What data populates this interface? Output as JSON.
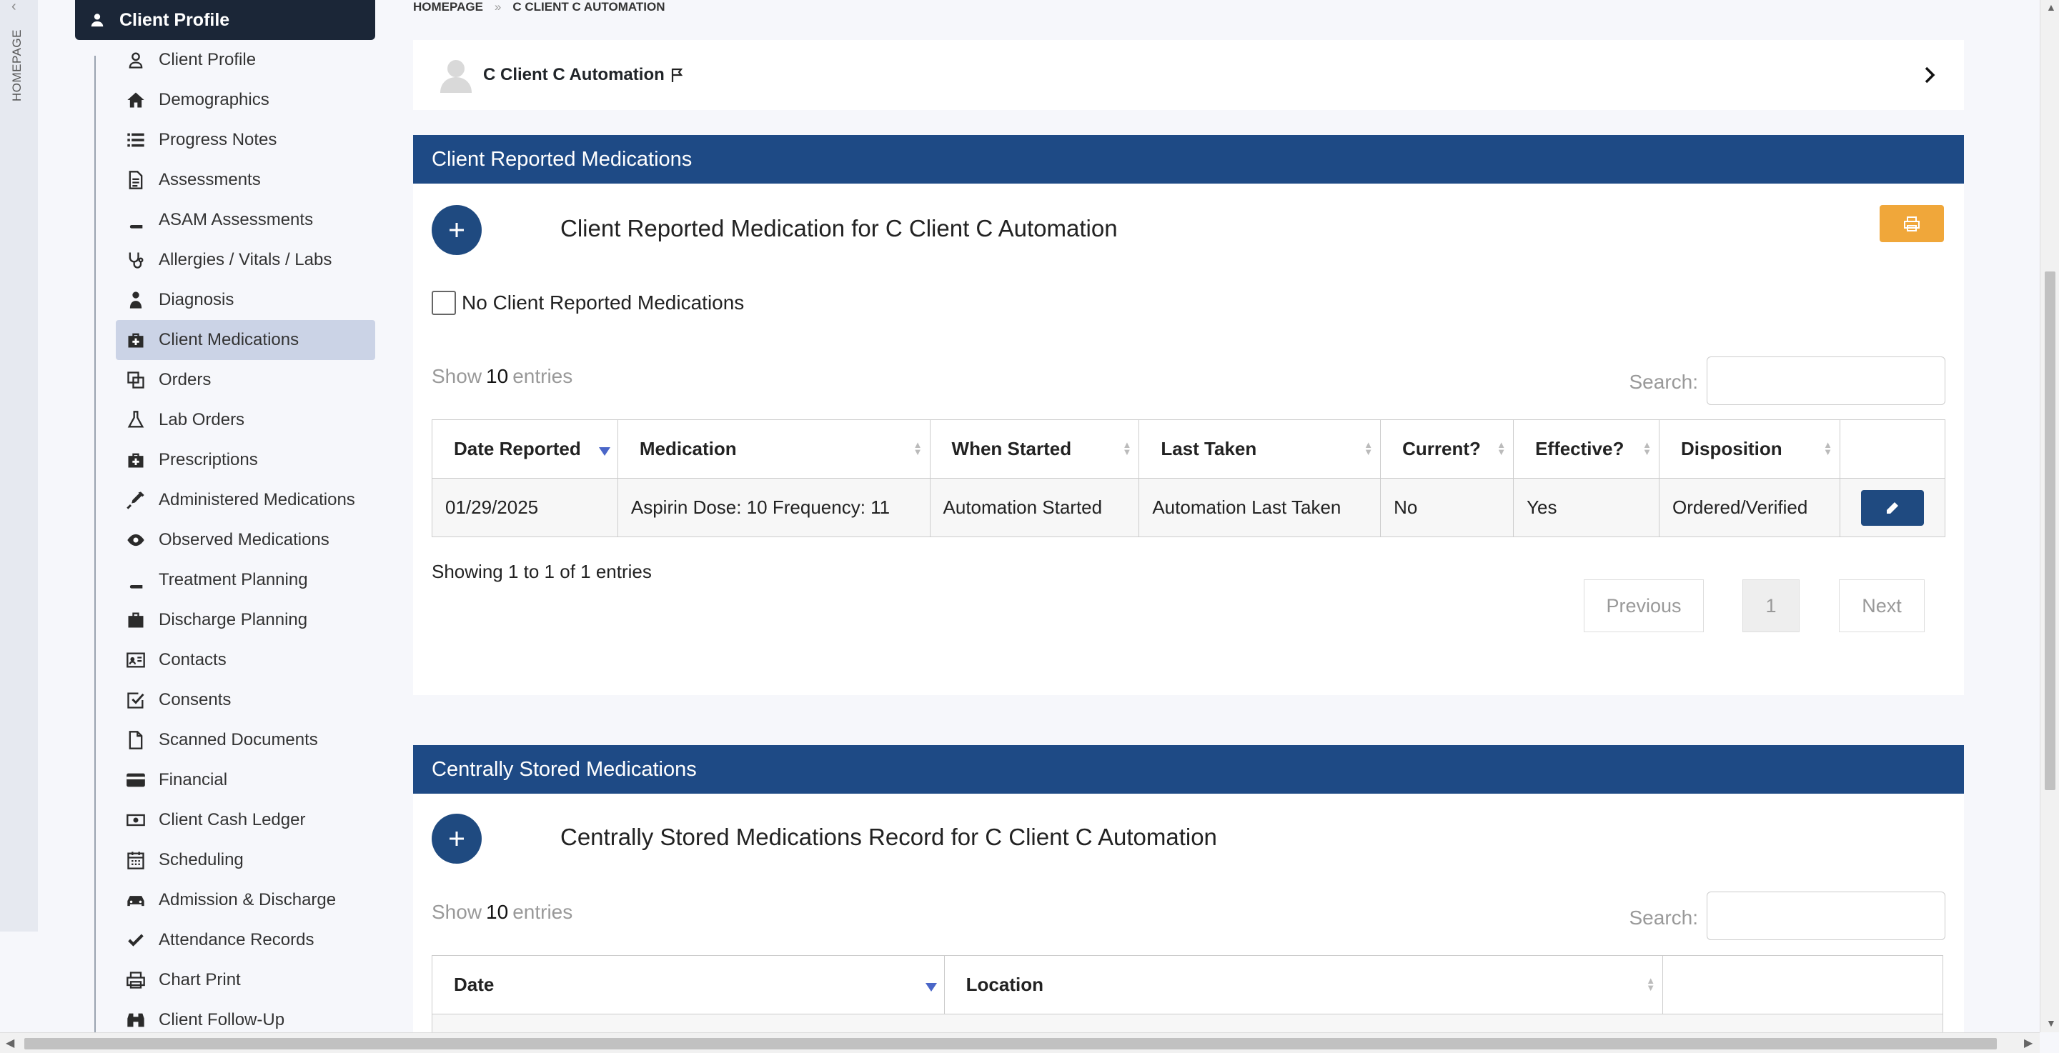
{
  "nav": {
    "collapse_icon": "chevron-left-icon",
    "vertical_label": "HOMEPAGE"
  },
  "sidebar": {
    "header": "Client Profile",
    "items": [
      {
        "label": "Client Profile",
        "icon": "person-icon"
      },
      {
        "label": "Demographics",
        "icon": "home-icon"
      },
      {
        "label": "Progress Notes",
        "icon": "list-icon"
      },
      {
        "label": "Assessments",
        "icon": "document-icon"
      },
      {
        "label": "ASAM Assessments",
        "icon": "book-icon"
      },
      {
        "label": "Allergies / Vitals / Labs",
        "icon": "stethoscope-icon"
      },
      {
        "label": "Diagnosis",
        "icon": "doctor-icon"
      },
      {
        "label": "Client Medications",
        "icon": "medkit-icon",
        "active": true
      },
      {
        "label": "Orders",
        "icon": "clone-icon"
      },
      {
        "label": "Lab Orders",
        "icon": "flask-icon"
      },
      {
        "label": "Prescriptions",
        "icon": "medkit-icon"
      },
      {
        "label": "Administered Medications",
        "icon": "syringe-icon"
      },
      {
        "label": "Observed Medications",
        "icon": "eye-icon"
      },
      {
        "label": "Treatment Planning",
        "icon": "book-icon"
      },
      {
        "label": "Discharge Planning",
        "icon": "briefcase-icon"
      },
      {
        "label": "Contacts",
        "icon": "address-card-icon"
      },
      {
        "label": "Consents",
        "icon": "check-square-icon"
      },
      {
        "label": "Scanned Documents",
        "icon": "file-icon"
      },
      {
        "label": "Financial",
        "icon": "credit-card-icon"
      },
      {
        "label": "Client Cash Ledger",
        "icon": "money-icon"
      },
      {
        "label": "Scheduling",
        "icon": "calendar-icon"
      },
      {
        "label": "Admission & Discharge",
        "icon": "car-icon"
      },
      {
        "label": "Attendance Records",
        "icon": "check-icon"
      },
      {
        "label": "Chart Print",
        "icon": "print-icon"
      },
      {
        "label": "Client Follow-Up",
        "icon": "binoculars-icon"
      }
    ]
  },
  "breadcrumb": {
    "home": "HOMEPAGE",
    "separator": "»",
    "current": "C CLIENT C AUTOMATION"
  },
  "client": {
    "name": "C Client C Automation"
  },
  "reported": {
    "header": "Client Reported Medications",
    "title": "Client Reported Medication for C Client C Automation",
    "no_meds_label": "No Client Reported Medications",
    "show_label": "Show",
    "entries_count": "10",
    "entries_label": "entries",
    "search_label": "Search:",
    "columns": [
      "Date Reported",
      "Medication",
      "When Started",
      "Last Taken",
      "Current?",
      "Effective?",
      "Disposition",
      ""
    ],
    "rows": [
      [
        "01/29/2025",
        "Aspirin Dose: 10 Frequency: 11",
        "Automation Started",
        "Automation Last Taken",
        "No",
        "Yes",
        "Ordered/Verified"
      ]
    ],
    "info": "Showing 1 to 1 of 1 entries",
    "prev": "Previous",
    "page": "1",
    "next": "Next"
  },
  "central": {
    "header": "Centrally Stored Medications",
    "title": "Centrally Stored Medications Record for C Client C Automation",
    "show_label": "Show",
    "entries_count": "10",
    "entries_label": "entries",
    "search_label": "Search:",
    "columns": [
      "Date",
      "Location",
      ""
    ]
  },
  "colors": {
    "sidebar_header": "#1b2637",
    "panel_header": "#1e4a85",
    "print_button": "#f0a73a",
    "active_item": "#cbd3e6"
  }
}
